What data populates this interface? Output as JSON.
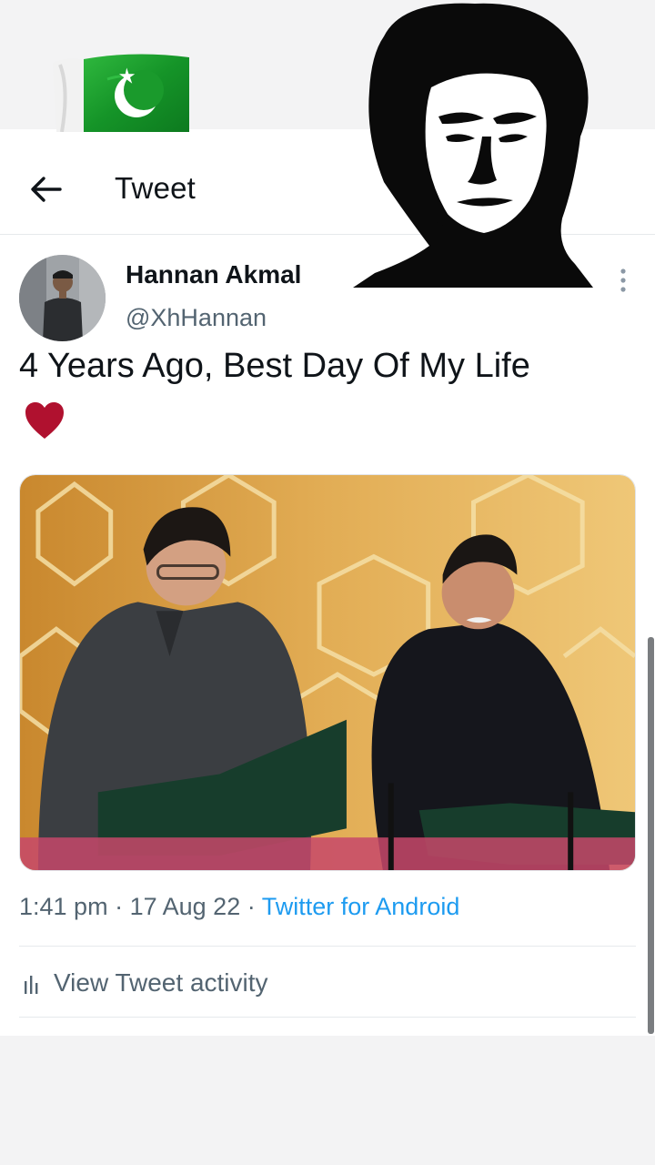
{
  "header": {
    "title": "Tweet"
  },
  "tweet": {
    "display_name": "Hannan Akmal",
    "handle": "@XhHannan",
    "text": "4 Years Ago, Best Day Of My Life",
    "emoji": "heart",
    "timestamp": "1:41 pm",
    "date": "17 Aug 22",
    "separator": "·",
    "source": "Twitter for Android",
    "activity_label": "View Tweet activity"
  },
  "icons": {
    "back": "arrow-left-icon",
    "more": "more-vertical-icon",
    "heart": "heart-icon",
    "activity": "bar-chart-icon"
  },
  "colors": {
    "accent": "#1d9bf0",
    "heart": "#b0112f",
    "text_primary": "#0f1419",
    "text_secondary": "#536471",
    "flag_green": "#1f9a2e"
  }
}
